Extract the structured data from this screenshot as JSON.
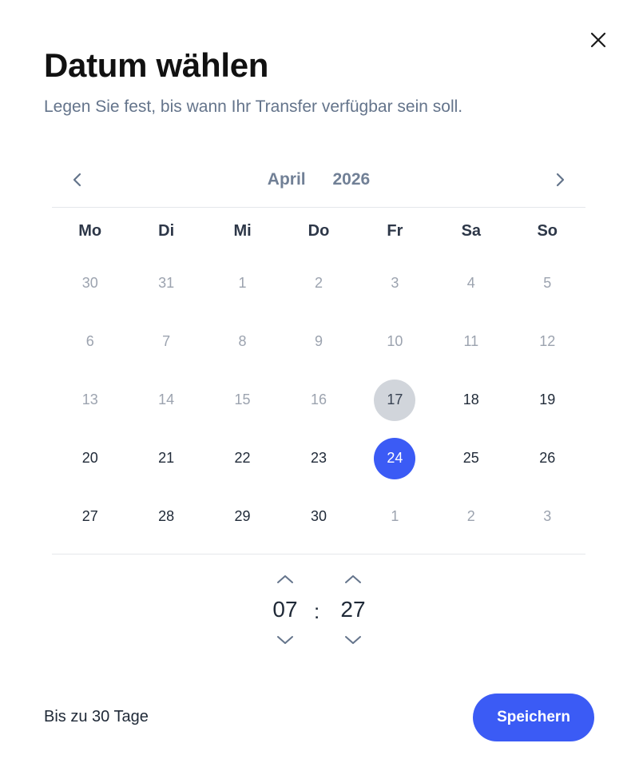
{
  "dialog": {
    "title": "Datum wählen",
    "subtitle": "Legen Sie fest, bis wann Ihr Transfer verfügbar sein soll."
  },
  "calendar": {
    "month": "April",
    "year": "2026",
    "weekdays": [
      "Mo",
      "Di",
      "Mi",
      "Do",
      "Fr",
      "Sa",
      "So"
    ],
    "weeks": [
      [
        {
          "d": "30",
          "m": true
        },
        {
          "d": "31",
          "m": true
        },
        {
          "d": "1",
          "m": true
        },
        {
          "d": "2",
          "m": true
        },
        {
          "d": "3",
          "m": true
        },
        {
          "d": "4",
          "m": true
        },
        {
          "d": "5",
          "m": true
        }
      ],
      [
        {
          "d": "6",
          "m": true
        },
        {
          "d": "7",
          "m": true
        },
        {
          "d": "8",
          "m": true
        },
        {
          "d": "9",
          "m": true
        },
        {
          "d": "10",
          "m": true
        },
        {
          "d": "11",
          "m": true
        },
        {
          "d": "12",
          "m": true
        }
      ],
      [
        {
          "d": "13",
          "m": true
        },
        {
          "d": "14",
          "m": true
        },
        {
          "d": "15",
          "m": true
        },
        {
          "d": "16",
          "m": true
        },
        {
          "d": "17",
          "m": false,
          "today": true
        },
        {
          "d": "18",
          "m": false
        },
        {
          "d": "19",
          "m": false
        }
      ],
      [
        {
          "d": "20",
          "m": false
        },
        {
          "d": "21",
          "m": false
        },
        {
          "d": "22",
          "m": false
        },
        {
          "d": "23",
          "m": false
        },
        {
          "d": "24",
          "m": false,
          "selected": true
        },
        {
          "d": "25",
          "m": false
        },
        {
          "d": "26",
          "m": false
        }
      ],
      [
        {
          "d": "27",
          "m": false
        },
        {
          "d": "28",
          "m": false
        },
        {
          "d": "29",
          "m": false
        },
        {
          "d": "30",
          "m": false
        },
        {
          "d": "1",
          "m": true
        },
        {
          "d": "2",
          "m": true
        },
        {
          "d": "3",
          "m": true
        }
      ]
    ]
  },
  "time": {
    "hour": "07",
    "minute": "27",
    "separator": ":"
  },
  "footer": {
    "note": "Bis zu 30 Tage",
    "save_label": "Speichern"
  },
  "colors": {
    "accent": "#3b5bf5",
    "today_bg": "#d1d5db",
    "muted_text": "#9ca3af"
  },
  "icons": {
    "close": "close-icon",
    "prev": "chevron-left-icon",
    "next": "chevron-right-icon",
    "up": "chevron-up-icon",
    "down": "chevron-down-icon"
  }
}
